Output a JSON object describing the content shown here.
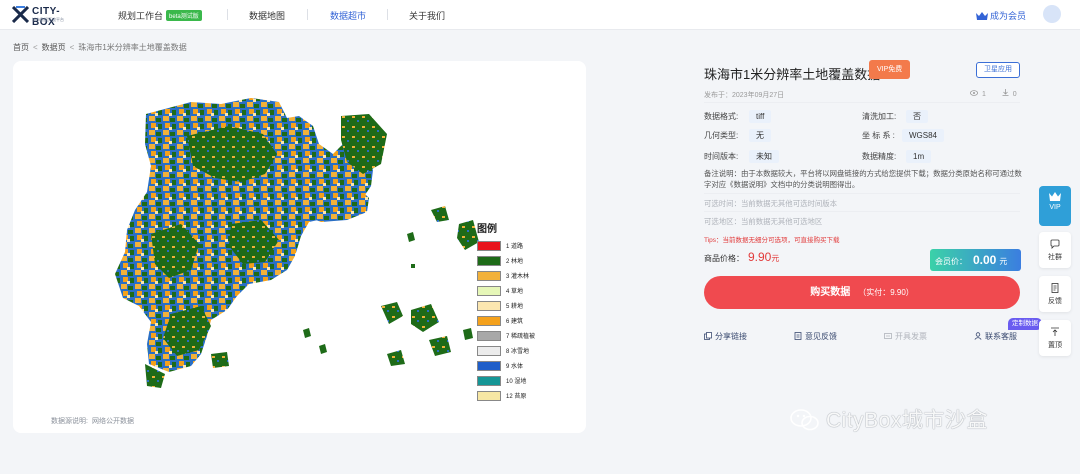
{
  "header": {
    "logo_name": "CITY-BOX",
    "logo_sub": "城市数据开放平台",
    "nav": [
      {
        "label": "规划工作台",
        "badge": "beta测试版"
      },
      {
        "label": "数据地图"
      },
      {
        "label": "数据超市",
        "active": true
      },
      {
        "label": "关于我们"
      }
    ],
    "vip_link": "成为会员",
    "accent_color": "#3363d6"
  },
  "breadcrumb": [
    "首页",
    "数据页",
    "珠海市1米分辨率土地覆盖数据"
  ],
  "map": {
    "legend_title": "图例",
    "legend": [
      {
        "label": "1 道路",
        "color": "#e8141b"
      },
      {
        "label": "2 林地",
        "color": "#1e6b18"
      },
      {
        "label": "3 灌木林",
        "color": "#f2b13a"
      },
      {
        "label": "4 草地",
        "color": "#e6f7b8"
      },
      {
        "label": "5 耕地",
        "color": "#fbe6b0"
      },
      {
        "label": "6 建筑",
        "color": "#f4a11c"
      },
      {
        "label": "7 稀疏植被",
        "color": "#a8a8a8"
      },
      {
        "label": "8 冰雪地",
        "color": "#ececec"
      },
      {
        "label": "9 水体",
        "color": "#1f5ec9"
      },
      {
        "label": "10 湿地",
        "color": "#159696"
      },
      {
        "label": "12 苔原",
        "color": "#f7e7a4"
      }
    ],
    "source_label": "数据源说明:",
    "source_value": "网络公开数据"
  },
  "detail": {
    "title": "珠海市1米分辨率土地覆盖数据",
    "vip_tag": "VIP免费",
    "satellite_btn": "卫星应用",
    "publish_date": "发布于：2023年09月27日",
    "views": "1",
    "downloads": "0",
    "fields": [
      {
        "label": "数据格式:",
        "value": "tiff"
      },
      {
        "label": "清洗加工:",
        "value": "否"
      },
      {
        "label": "几何类型:",
        "value": "无"
      },
      {
        "label": "坐 标 系 :",
        "value": "WGS84"
      },
      {
        "label": "时间版本:",
        "value": "未知"
      },
      {
        "label": "数据精度:",
        "value": "1m"
      }
    ],
    "note": "备注说明：由于本数据较大，平台将以网盘链接的方式给您提供下载；数据分类原始名称可通过数字对应《数据说明》文档中的分类说明图得出。",
    "opt_time": "可选时间：当前数据无其他可选时间版本",
    "opt_area": "可选地区：当前数据无其他可选地区",
    "tips": "Tips：当前数据无细分可选项，可直接购买下载",
    "price_label": "商品价格：",
    "price": "9.90",
    "price_unit": "元",
    "member_label": "会员价：",
    "member_price": "0.00",
    "member_unit": "元",
    "buy_label": "购买数据",
    "buy_actual": "（实付：9.90）",
    "actions": [
      {
        "label": "分享链接",
        "enabled": true
      },
      {
        "label": "意见反馈",
        "enabled": true
      },
      {
        "label": "开具发票",
        "enabled": false
      },
      {
        "label": "联系客服",
        "enabled": true
      }
    ],
    "custom_tag": "定制数据"
  },
  "sidebar": {
    "vip": "VIP",
    "items": [
      "社群",
      "反馈",
      "置顶"
    ]
  },
  "watermark": "CityBox城市沙盒"
}
